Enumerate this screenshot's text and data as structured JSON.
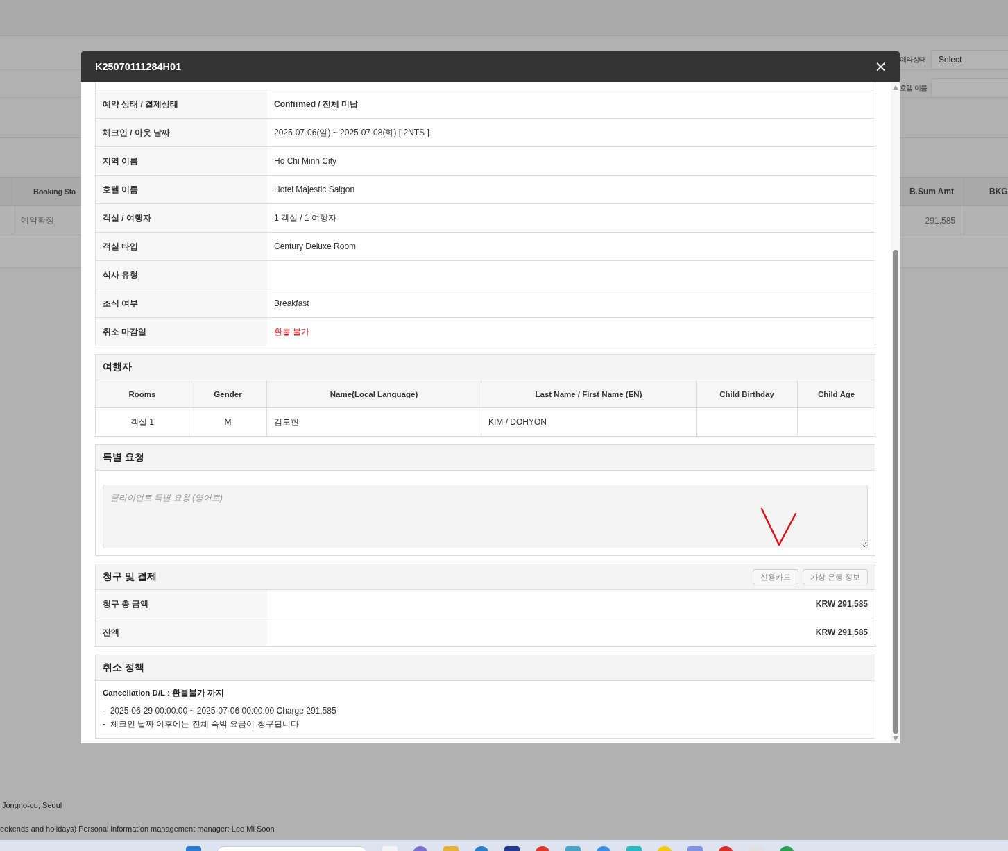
{
  "background": {
    "filters": [
      {
        "label": "예약상태",
        "value": "Select"
      },
      {
        "label": "호텔 이름"
      }
    ],
    "table": {
      "columns": [
        "Booking Sta",
        "B.Sum Amt",
        "BKG"
      ],
      "rows": [
        {
          "booking_status": "예약확정",
          "b_sum_amt": "291,585"
        }
      ]
    },
    "footer": [
      "Jongno-gu, Seoul",
      "eekends and holidays) Personal information management manager: Lee Mi Soon"
    ]
  },
  "modal": {
    "title": "K25070111284H01",
    "close": "×",
    "details": [
      {
        "label": "예약 상태 / 결제상태",
        "value": "Confirmed / 전체 미납",
        "kind": "bold"
      },
      {
        "label": "체크인 / 아웃 날짜",
        "value": "2025-07-06(일) ~ 2025-07-08(화) [ 2NTS ]",
        "kind": "plain"
      },
      {
        "label": "지역 이름",
        "value": "Ho Chi Minh City",
        "kind": "plain"
      },
      {
        "label": "호텔 이름",
        "value": "Hotel Majestic Saigon",
        "kind": "plain"
      },
      {
        "label": "객실 / 여행자",
        "value": "1 객실 / 1 여행자",
        "kind": "plain"
      },
      {
        "label": "객실 타입",
        "value": "Century Deluxe Room",
        "kind": "plain"
      },
      {
        "label": "식사 유형",
        "kind": "plain"
      },
      {
        "label": "조식 여부",
        "value": "Breakfast",
        "kind": "plain"
      },
      {
        "label": "취소 마감일",
        "value": "환불 불가",
        "kind": "alert"
      }
    ],
    "travelers": {
      "title": "여행자",
      "columns": [
        "Rooms",
        "Gender",
        "Name(Local Language)",
        "Last Name / First Name (EN)",
        "Child Birthday",
        "Child Age"
      ],
      "rows": [
        {
          "cells": [
            "객실 1",
            "M",
            "김도현",
            "KIM / DOHYON"
          ]
        }
      ]
    },
    "special_request": {
      "title": "특별 요청",
      "placeholder": "클라이언트 특별 요청 (영어로)"
    },
    "billing": {
      "title": "청구 및 결제",
      "buttons": [
        "신용카드",
        "가상 은행 정보"
      ],
      "rows": [
        {
          "label": "청구 총 금액",
          "value": "KRW 291,585"
        },
        {
          "label": "잔액",
          "value": "KRW 291,585"
        }
      ]
    },
    "cancellation": {
      "title": "취소 정책",
      "heading": "Cancellation D/L : 환불불가 까지",
      "lines": [
        "-  2025-06-29 00:00:00 ~ 2025-07-06 00:00:00 Charge 291,585",
        "-  체크인 날짜 이후에는 전체 숙박 요금이 청구됩니다"
      ]
    }
  }
}
